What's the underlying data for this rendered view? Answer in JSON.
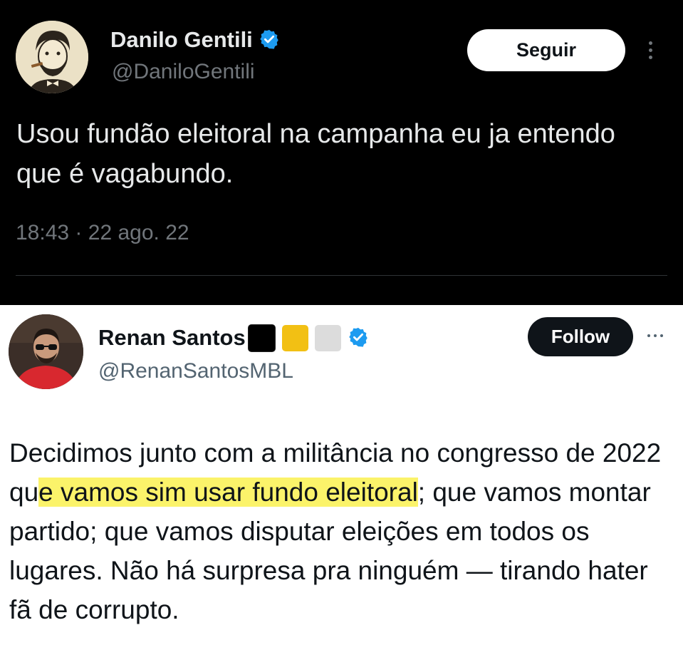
{
  "tweet1": {
    "name": "Danilo Gentili",
    "handle": "@DaniloGentili",
    "follow_label": "Seguir",
    "text": "Usou fundão eleitoral na campanha eu ja entendo que é vagabundo.",
    "time": "18:43",
    "separator": "·",
    "date": "22 ago. 22",
    "verified_icon": "verified-badge-icon",
    "more_icon": "more-vertical-icon"
  },
  "tweet2": {
    "name": "Renan Santos",
    "handle": "@RenanSantosMBL",
    "follow_label": "Follow",
    "text_before": "Decidimos junto com a militância no congresso de 2022 qu",
    "text_highlight": "e vamos sim usar fundo eleitoral",
    "text_after": "; que vamos montar partido; que vamos disputar eleições em todos os lugares. Não há surpresa pra ninguém — tirando hater fã de corrupto.",
    "name_squares": [
      "#000000",
      "#f2c014",
      "#d9d9d9"
    ],
    "highlight_color": "#fbf36a",
    "verified_icon": "verified-badge-icon",
    "more_icon": "more-horizontal-icon"
  },
  "colors": {
    "verified_blue": "#1d9bf0",
    "dark_bg": "#000000",
    "dark_text": "#e7e9ea",
    "dark_secondary": "#71767b",
    "light_text": "#0f1419",
    "light_secondary": "#536471"
  }
}
